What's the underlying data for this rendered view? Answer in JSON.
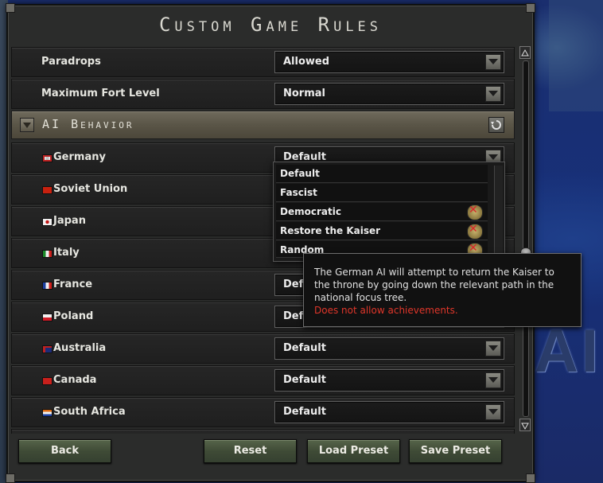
{
  "window": {
    "title": "Custom Game Rules"
  },
  "map": {
    "label_text": "AI"
  },
  "rows_top": [
    {
      "label": "Paradrops",
      "value": "Allowed"
    },
    {
      "label": "Maximum Fort Level",
      "value": "Normal"
    }
  ],
  "section": {
    "title": "AI Behavior"
  },
  "countries": [
    {
      "name": "Germany",
      "value": "Default"
    },
    {
      "name": "Soviet Union",
      "value": ""
    },
    {
      "name": "Japan",
      "value": ""
    },
    {
      "name": "Italy",
      "value": ""
    },
    {
      "name": "France",
      "value": "Defa"
    },
    {
      "name": "Poland",
      "value": "Defa"
    },
    {
      "name": "Australia",
      "value": "Default"
    },
    {
      "name": "Canada",
      "value": "Default"
    },
    {
      "name": "South Africa",
      "value": "Default"
    }
  ],
  "popup": {
    "options": [
      {
        "label": "Default",
        "achievement_blocked": false
      },
      {
        "label": "Fascist",
        "achievement_blocked": false
      },
      {
        "label": "Democratic",
        "achievement_blocked": true
      },
      {
        "label": "Restore the Kaiser",
        "achievement_blocked": true
      },
      {
        "label": "Random",
        "achievement_blocked": true
      }
    ]
  },
  "tooltip": {
    "text": "The German AI will attempt to return the Kaiser to the throne by going down the relevant path in the national focus tree.",
    "warning": "Does not allow achievements."
  },
  "buttons": {
    "back": "Back",
    "reset": "Reset",
    "load_preset": "Load Preset",
    "save_preset": "Save Preset"
  },
  "icons": {
    "section_toggle": "collapse-arrow-icon",
    "section_reset": "reset-icon",
    "dropdown": "chevron-down-icon",
    "blocked": "achievement-blocked-icon"
  },
  "colors": {
    "warning": "#e0362a",
    "button_green": "#4a5840",
    "section_bar": "#5a5547"
  }
}
